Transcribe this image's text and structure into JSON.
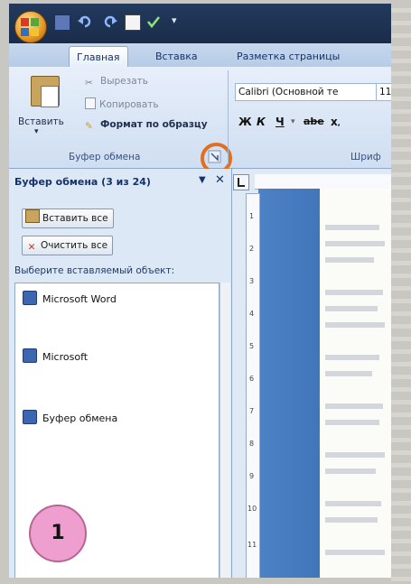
{
  "quick_access": {
    "icons": [
      "office-button-icon",
      "save-icon",
      "undo-icon",
      "redo-icon",
      "print-preview-icon",
      "spelling-icon"
    ]
  },
  "tabs": [
    {
      "label": "Главная",
      "active": true
    },
    {
      "label": "Вставка",
      "active": false
    },
    {
      "label": "Разметка страницы",
      "active": false
    }
  ],
  "ribbon": {
    "clipboard": {
      "paste_label": "Вставить",
      "cut_label": "Вырезать",
      "copy_label": "Копировать",
      "format_painter_label": "Формат по образцу",
      "group_label": "Буфер обмена"
    },
    "font": {
      "font_name": "Calibri (Основной те",
      "font_size": "11",
      "bold": "Ж",
      "italic": "К",
      "underline": "Ч",
      "strikethrough": "abe",
      "subscript": "x",
      "group_label": "Шриф"
    }
  },
  "pane": {
    "title": "Буфер обмена (3 из 24)",
    "paste_all": "Вставить все",
    "clear_all": "Очистить все",
    "select_label": "Выберите вставляемый объект:",
    "items": [
      {
        "label": "Microsoft Word"
      },
      {
        "label": "Microsoft"
      },
      {
        "label": "Буфер обмена"
      }
    ]
  },
  "doc": {
    "ruler_numbers": [
      "1",
      "2",
      "3",
      "4",
      "5",
      "6",
      "7",
      "8",
      "9",
      "10",
      "11"
    ]
  },
  "badge": "1",
  "colors": {
    "accent_ring": "#e0701f",
    "badge": "#ee9fd0",
    "doc_blue": "#3a6fb5"
  }
}
